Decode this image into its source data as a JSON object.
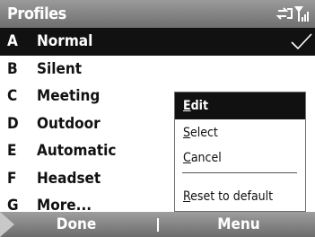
{
  "titlebar": {
    "title": "Profiles",
    "icons": [
      "connectivity-icon",
      "signal-icon"
    ]
  },
  "profiles": [
    {
      "key": "A",
      "label": "Normal",
      "selected": true,
      "checked": true
    },
    {
      "key": "B",
      "label": "Silent"
    },
    {
      "key": "C",
      "label": "Meeting"
    },
    {
      "key": "D",
      "label": "Outdoor"
    },
    {
      "key": "E",
      "label": "Automatic"
    },
    {
      "key": "F",
      "label": "Headset"
    },
    {
      "key": "G",
      "label": "More..."
    }
  ],
  "context_menu": {
    "items": [
      {
        "accel": "E",
        "rest": "dit",
        "active": true
      },
      {
        "accel": "S",
        "rest": "elect"
      },
      {
        "accel": "C",
        "rest": "ancel"
      },
      {
        "accel": "R",
        "rest": "eset to default"
      }
    ]
  },
  "softkeys": {
    "left": "Done",
    "right": "Menu"
  },
  "colors": {
    "selection": "#111111",
    "bar": "#6f6f6f",
    "text": "#111111"
  }
}
